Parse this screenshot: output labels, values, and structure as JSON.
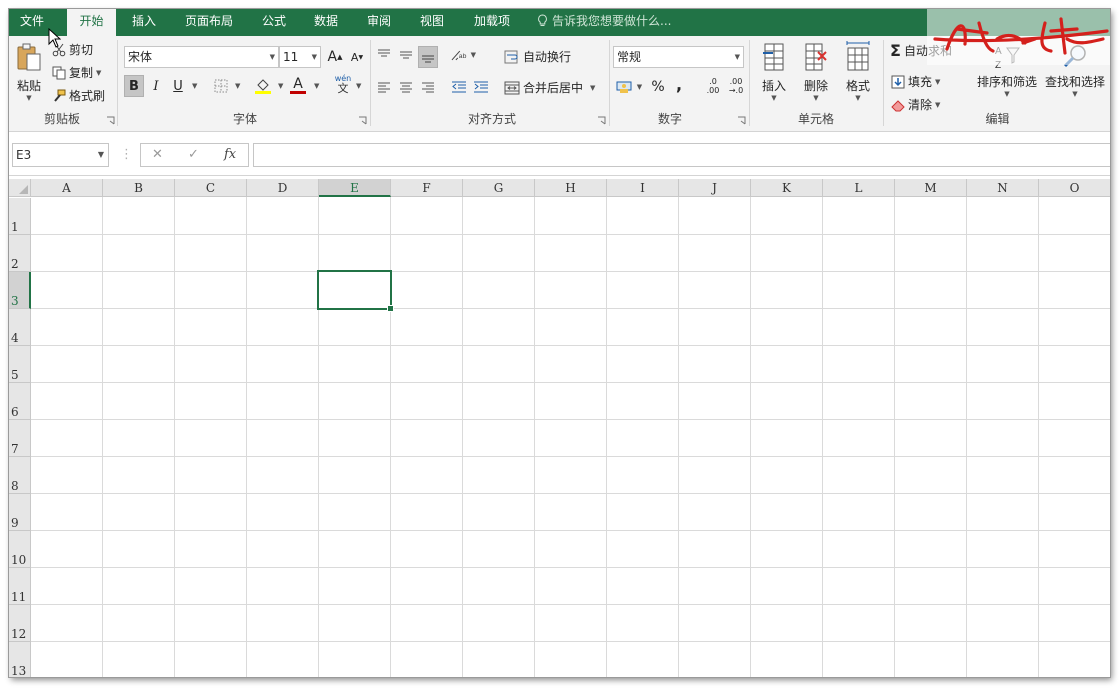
{
  "menu": {
    "tabs": [
      "文件",
      "开始",
      "插入",
      "页面布局",
      "公式",
      "数据",
      "审阅",
      "视图",
      "加载项"
    ],
    "active_tab": "开始",
    "tell_me": "告诉我您想要做什么..."
  },
  "ribbon": {
    "clipboard": {
      "paste": "粘贴",
      "cut": "剪切",
      "copy": "复制",
      "format_painter": "格式刷",
      "label": "剪贴板"
    },
    "font": {
      "font_name": "宋体",
      "font_size": "11",
      "bold": "B",
      "italic": "I",
      "underline": "U",
      "phonetic": "wén",
      "phonetic_char": "文",
      "grow": "A",
      "shrink": "A",
      "font_color": "A",
      "label": "字体"
    },
    "alignment": {
      "wrap_text": "自动换行",
      "merge_center": "合并后居中",
      "label": "对齐方式"
    },
    "number": {
      "format": "常规",
      "percent": "%",
      "comma": ",",
      "inc_decimal_top": ".0",
      "inc_decimal_bottom": ".00",
      "dec_decimal_top": ".00",
      "dec_decimal_bottom": "→.0",
      "label": "数字"
    },
    "cells": {
      "insert": "插入",
      "delete": "删除",
      "format": "格式",
      "label": "单元格"
    },
    "editing": {
      "autosum": "自动求和",
      "fill": "填充",
      "clear": "清除",
      "sort_filter": "排序和筛选",
      "find_select": "查找和选择",
      "label": "编辑"
    }
  },
  "formula_bar": {
    "name_box": "E3",
    "cancel": "✕",
    "enter": "✓",
    "fx": "fx",
    "value": ""
  },
  "sheet": {
    "columns": [
      "A",
      "B",
      "C",
      "D",
      "E",
      "F",
      "G",
      "H",
      "I",
      "J",
      "K",
      "L",
      "M",
      "N",
      "O"
    ],
    "rows": [
      "1",
      "2",
      "3",
      "4",
      "5",
      "6",
      "7",
      "8",
      "9",
      "10",
      "11",
      "12",
      "13"
    ],
    "selected_cell": "E3",
    "selected_column": "E",
    "selected_row": "3"
  },
  "colors": {
    "accent": "#217346",
    "ribbon_bg": "#f3f3f3",
    "header_bg": "#e6e6e6",
    "gridline": "#dadada"
  }
}
